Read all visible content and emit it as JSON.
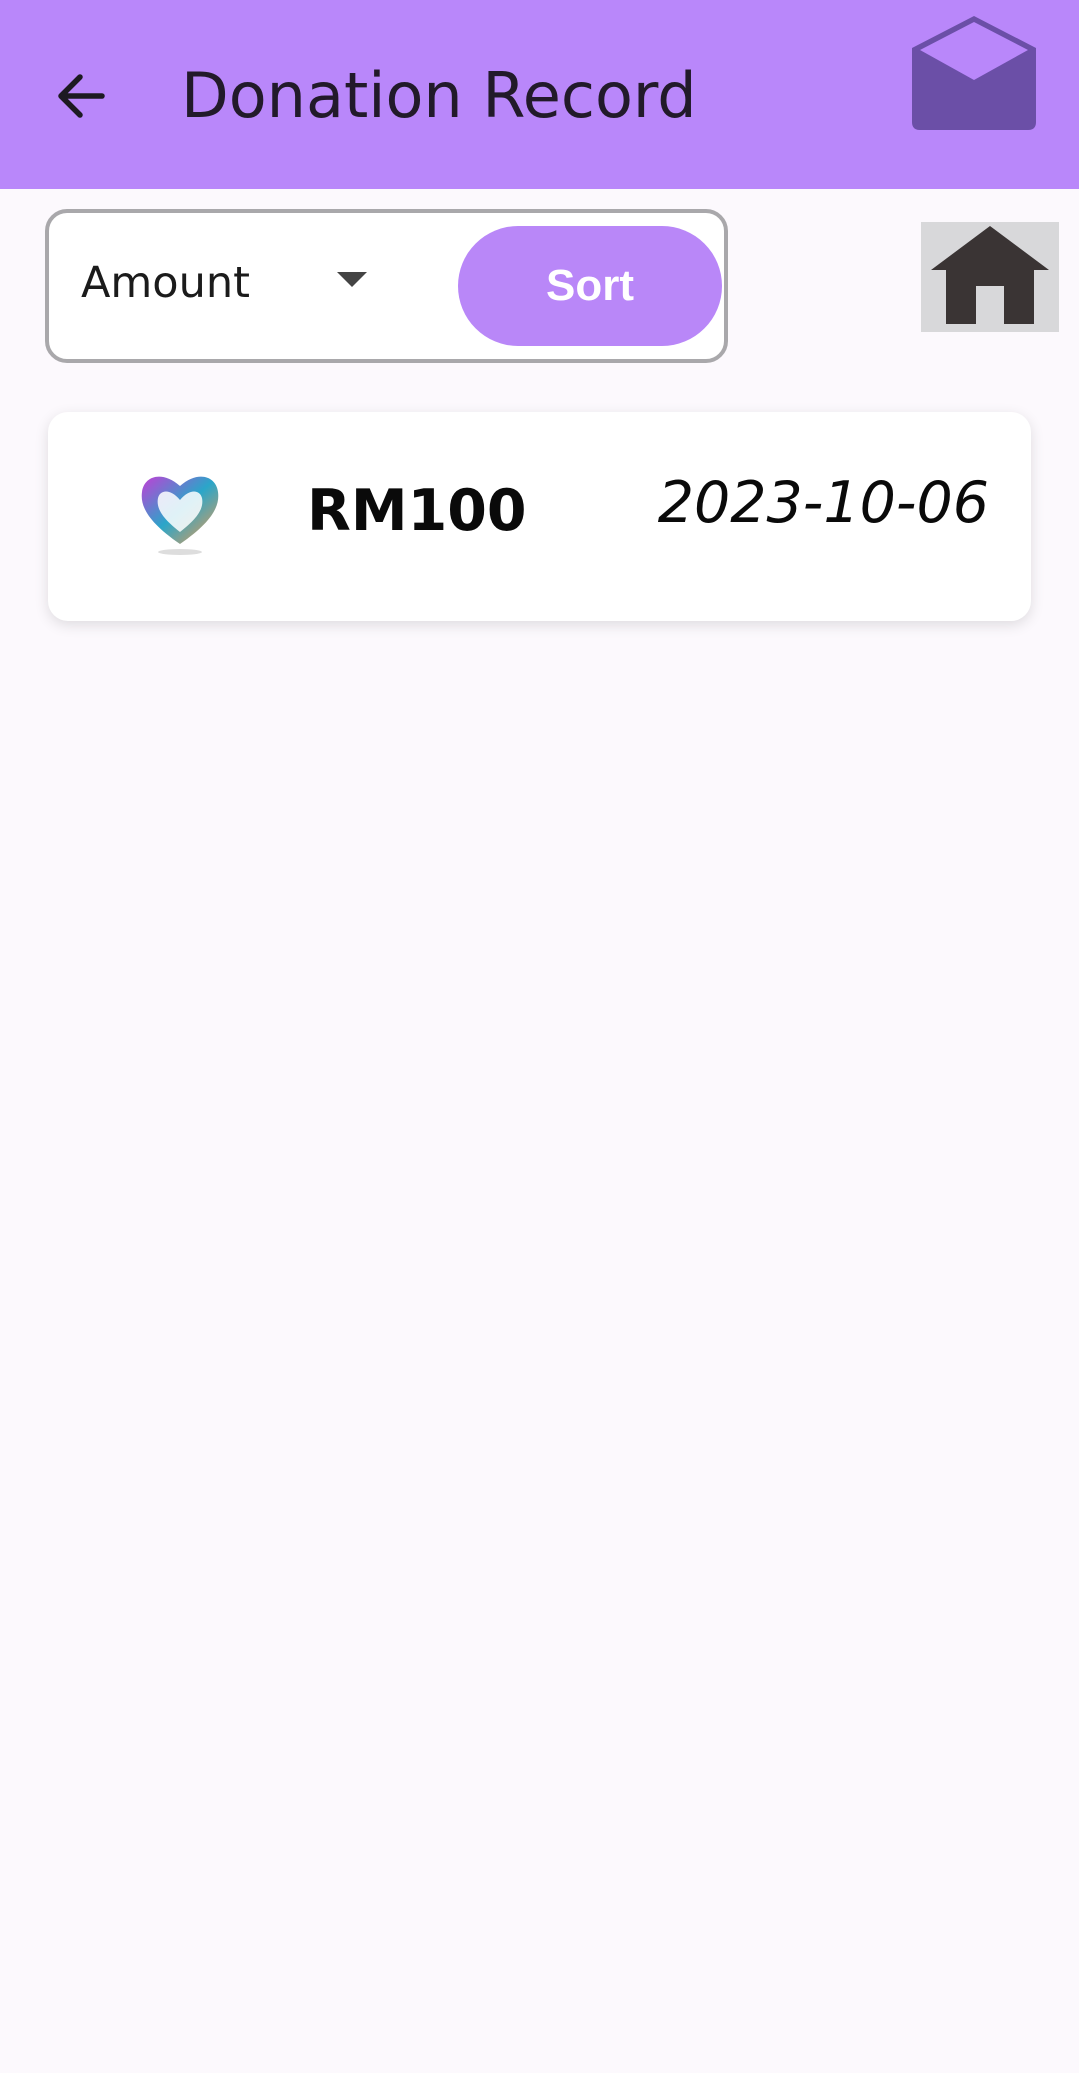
{
  "app_bar": {
    "title": "Donation Record",
    "back_icon": "arrow-left-icon",
    "mail_icon": "open-envelope-icon",
    "background_color": "#b987fa"
  },
  "sort_bar": {
    "selected_field": "Amount",
    "sort_label": "Sort",
    "home_icon": "home-icon"
  },
  "records": [
    {
      "logo": "heart-hands-logo",
      "amount": "RM100",
      "date": "2023-10-06"
    }
  ]
}
